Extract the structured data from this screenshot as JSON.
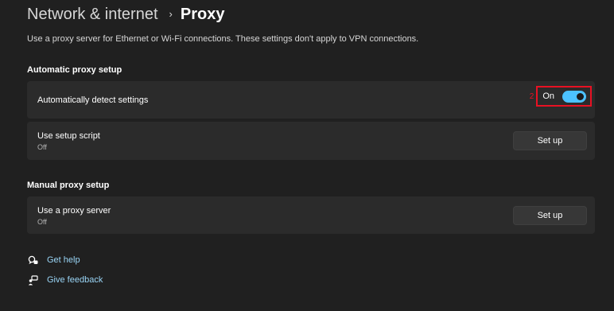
{
  "breadcrumb": {
    "parent": "Network & internet",
    "separator": "›",
    "current": "Proxy"
  },
  "description": "Use a proxy server for Ethernet or Wi-Fi connections. These settings don't apply to VPN connections.",
  "automatic": {
    "heading": "Automatic proxy setup",
    "detect_settings": {
      "label": "Automatically detect settings",
      "toggle_state": "On",
      "toggle_on": true,
      "marker": "2"
    },
    "setup_script": {
      "label": "Use setup script",
      "status": "Off",
      "button_label": "Set up"
    }
  },
  "manual": {
    "heading": "Manual proxy setup",
    "proxy_server": {
      "label": "Use a proxy server",
      "status": "Off",
      "button_label": "Set up"
    }
  },
  "links": {
    "get_help": "Get help",
    "give_feedback": "Give feedback"
  },
  "colors": {
    "background": "#202020",
    "card": "#2b2b2b",
    "accent": "#4cc2ff",
    "link": "#99d4f5",
    "highlight": "#e81123"
  }
}
